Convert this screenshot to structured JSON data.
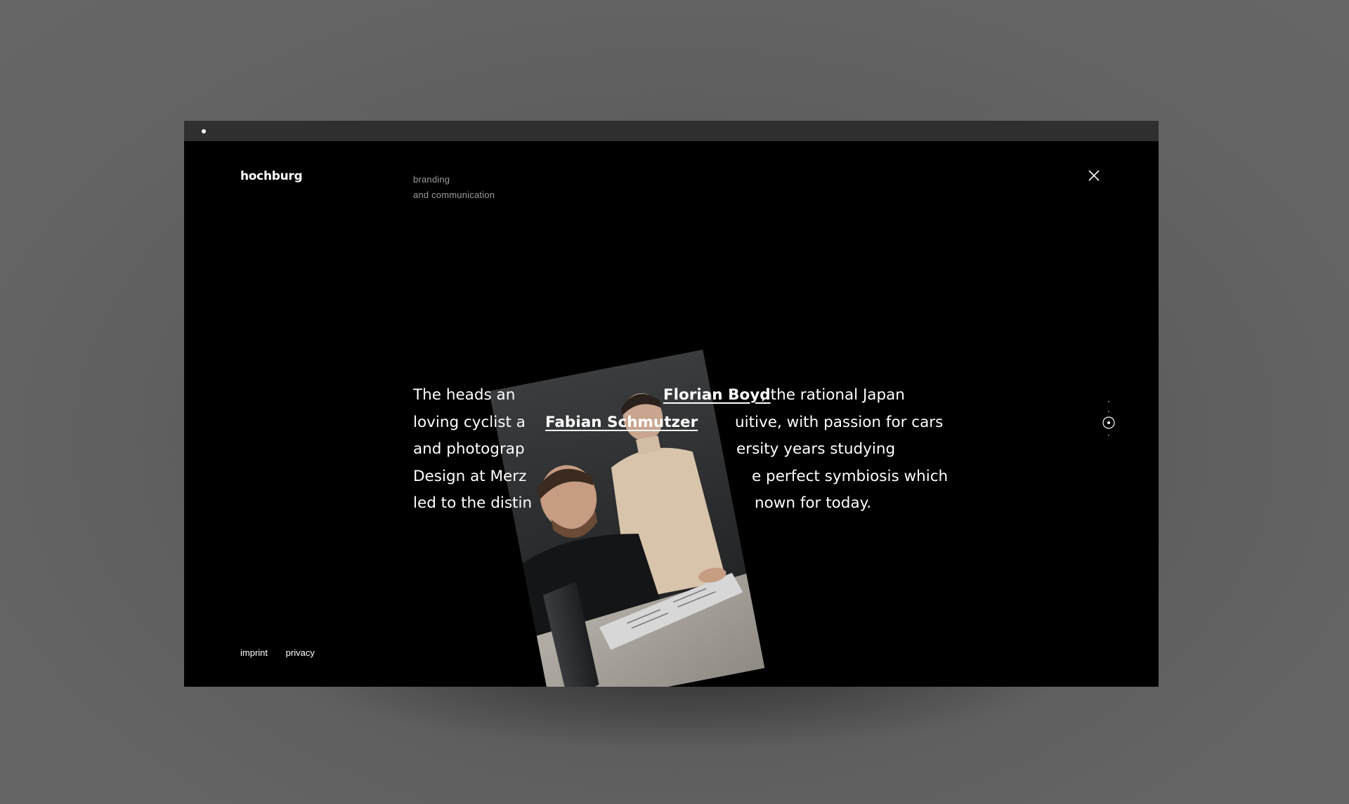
{
  "brand": {
    "logo": "hochburg"
  },
  "tagline": {
    "line1": "branding",
    "line2": "and communication"
  },
  "body": {
    "line1_a": "The heads an",
    "line1_b": ", the rational Japan",
    "line2_a": "loving cyclist a",
    "line2_b": "uitive, with passion for cars",
    "line3_a": "and photograp",
    "line3_b": "ersity years studying",
    "line4_a": "Design at Merz",
    "line4_b": "e perfect symbiosis which",
    "line5_a": "led to the distin",
    "line5_b": "nown for today.",
    "link_florian": "Florian Boyd",
    "link_fabian": "Fabian Schmutzer"
  },
  "footer": {
    "imprint": "imprint",
    "privacy": "privacy"
  },
  "icons": {
    "close": "close-icon",
    "scroll": "scroll-indicator-icon"
  },
  "colors": {
    "background": "#000000",
    "text": "#ffffff",
    "muted": "#9a9a9a",
    "desk": "#a8a49d"
  }
}
